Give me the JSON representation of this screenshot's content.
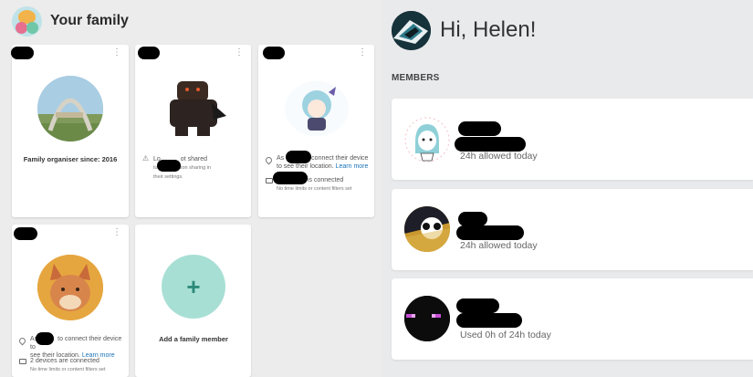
{
  "family": {
    "title": "Your family",
    "cards": [
      {
        "caption": "Family organiser since: 2016"
      },
      {
        "status_prefix": "Lo",
        "status_mid": "ot shared",
        "status_sub": "turn on location sharing in",
        "status_sub2": "their settings."
      },
      {
        "loc_prefix": "As",
        "loc_suffix": "connect their device",
        "loc_line2": "to see their location.",
        "loc_link": "Learn more",
        "dev_suffix": "is connected",
        "dev_sub": "No time limits or content filters set"
      },
      {
        "loc_prefix": "As",
        "loc_suffix": "to connect their device to",
        "loc_line2": "see their location.",
        "loc_link": "Learn more",
        "dev_text": "2 devices are connected",
        "dev_sub": "No time limits or content filters set"
      }
    ],
    "add_label": "Add a family member",
    "add_symbol": "+",
    "menu_symbol": "⋮"
  },
  "greeting": "Hi, Helen!",
  "members_label": "MEMBERS",
  "members": [
    {
      "allowance": "24h allowed today"
    },
    {
      "allowance": "24h allowed today"
    },
    {
      "allowance": "Used 0h of 24h today"
    }
  ],
  "colors": {
    "add_circle": "#a8dfd4",
    "link": "#1a73b8",
    "panel_left": "#ececec",
    "panel_right": "#e9eaec"
  }
}
